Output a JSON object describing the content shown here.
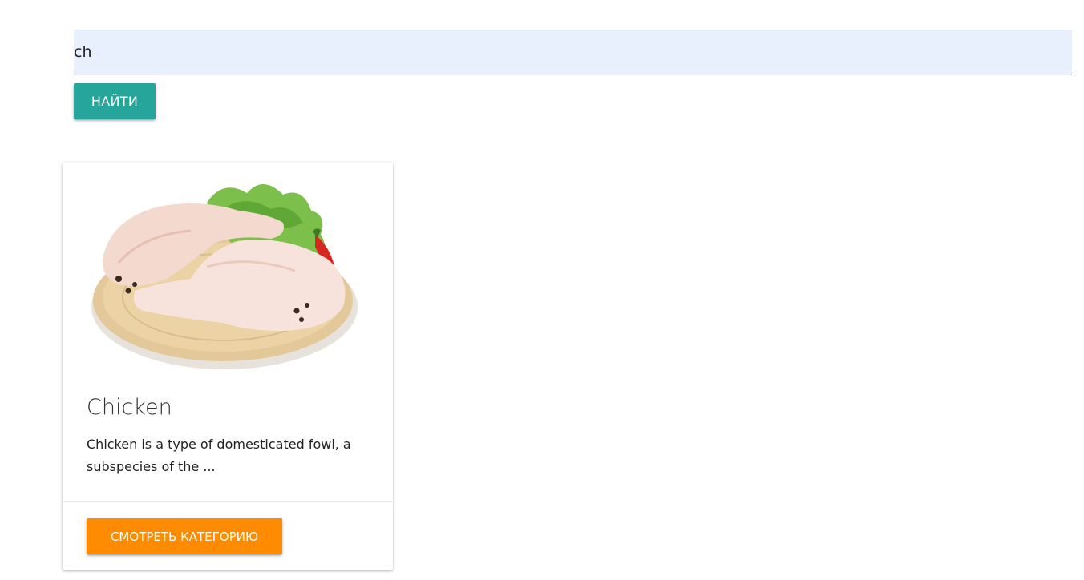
{
  "search": {
    "value": "ch",
    "button_label": "НАЙТИ"
  },
  "results": [
    {
      "title": "Chicken",
      "description": "Chicken is a type of domesticated fowl, a subspecies of the ...",
      "image_icon": "raw-chicken-legs-on-wooden-board",
      "button_label": "СМОТРЕТЬ КАТЕГОРИЮ"
    }
  ],
  "colors": {
    "input_bg": "#e8f0fe",
    "find_button": "#26a69a",
    "category_button": "#ff8c00"
  }
}
